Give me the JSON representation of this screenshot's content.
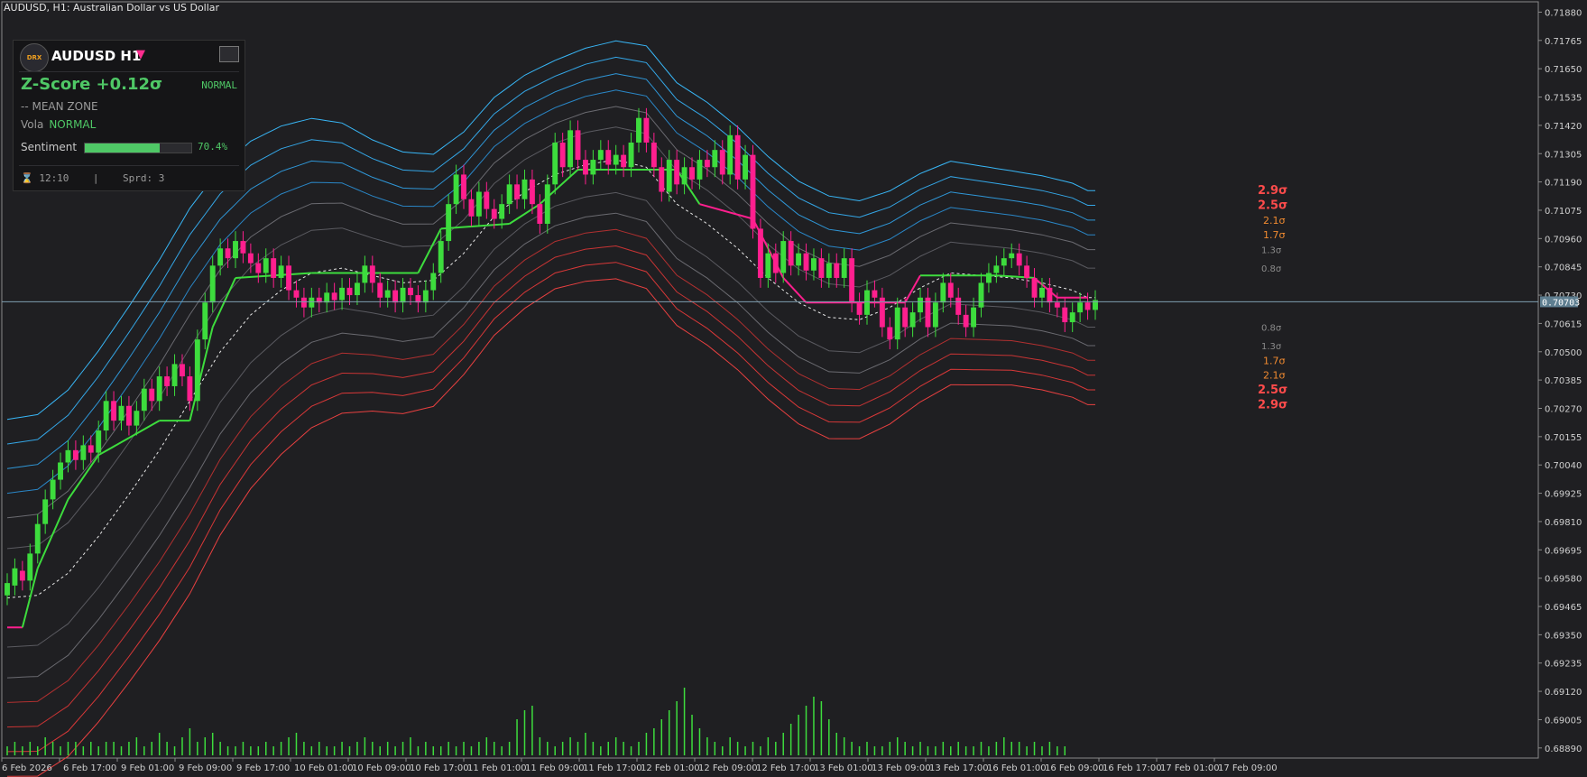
{
  "header": {
    "title": "AUDUSD, H1:  Australian Dollar vs US Dollar"
  },
  "panel": {
    "logo": "DRX",
    "symbol": "AUDUSD H1",
    "arrow": "▼",
    "zscore_label": "Z-Score  +0.12σ",
    "state": "NORMAL",
    "zone": "-- MEAN ZONE",
    "vola_label": "Vola",
    "vola_value": "NORMAL",
    "sentiment_label": "Sentiment",
    "sentiment_pct": "70.4%",
    "sentiment_value": 0.704,
    "timer_icon": "hourglass-icon",
    "footer": "⌛ 12:10    |    Sprd: 3"
  },
  "colors": {
    "bull": "#3ddc3d",
    "bear": "#ff1f8e",
    "neutral": "#707078",
    "upper": "#2fa8e8",
    "lower": "#e03838"
  },
  "chart_data": {
    "type": "candlestick",
    "symbol": "AUDUSD",
    "timeframe": "H1",
    "current_price": "0.70703",
    "y_ticks": [
      "0.71880",
      "0.71765",
      "0.71650",
      "0.71535",
      "0.71420",
      "0.71305",
      "0.71190",
      "0.71075",
      "0.70960",
      "0.70845",
      "0.70730",
      "0.70615",
      "0.70500",
      "0.70385",
      "0.70270",
      "0.70155",
      "0.70040",
      "0.69925",
      "0.69810",
      "0.69695",
      "0.69580",
      "0.69465",
      "0.69350",
      "0.69235",
      "0.69120",
      "0.69005",
      "0.68890"
    ],
    "ylim": [
      0.6886,
      0.719
    ],
    "x_ticks": [
      "6 Feb 2026",
      "6 Feb 17:00",
      "9 Feb 01:00",
      "9 Feb 09:00",
      "9 Feb 17:00",
      "10 Feb 01:00",
      "10 Feb 09:00",
      "10 Feb 17:00",
      "11 Feb 01:00",
      "11 Feb 09:00",
      "11 Feb 17:00",
      "12 Feb 01:00",
      "12 Feb 09:00",
      "12 Feb 17:00",
      "13 Feb 01:00",
      "13 Feb 09:00",
      "13 Feb 17:00",
      "16 Feb 01:00",
      "16 Feb 09:00",
      "16 Feb 17:00",
      "17 Feb 01:00",
      "17 Feb 09:00"
    ],
    "sigma_labels_upper": [
      "2.9σ",
      "2.5σ",
      "2.1σ",
      "1.7σ",
      "1.3σ",
      "0.8σ"
    ],
    "sigma_labels_lower": [
      "0.8σ",
      "1.3σ",
      "1.7σ",
      "2.1σ",
      "2.5σ",
      "2.9σ"
    ],
    "sigma_levels": [
      0.8,
      1.3,
      1.7,
      2.1,
      2.5,
      2.9
    ],
    "mean": [
      [
        0,
        0.695
      ],
      [
        4,
        0.6951
      ],
      [
        8,
        0.696
      ],
      [
        12,
        0.6975
      ],
      [
        16,
        0.6992
      ],
      [
        20,
        0.701
      ],
      [
        24,
        0.703
      ],
      [
        28,
        0.705
      ],
      [
        32,
        0.7065
      ],
      [
        36,
        0.7075
      ],
      [
        40,
        0.7082
      ],
      [
        44,
        0.7084
      ],
      [
        48,
        0.7081
      ],
      [
        52,
        0.7078
      ],
      [
        56,
        0.7079
      ],
      [
        60,
        0.709
      ],
      [
        64,
        0.7105
      ],
      [
        68,
        0.7115
      ],
      [
        72,
        0.7122
      ],
      [
        76,
        0.7126
      ],
      [
        80,
        0.7128
      ],
      [
        84,
        0.7125
      ],
      [
        88,
        0.711
      ],
      [
        92,
        0.7102
      ],
      [
        96,
        0.7092
      ],
      [
        100,
        0.708
      ],
      [
        104,
        0.707
      ],
      [
        108,
        0.7064
      ],
      [
        112,
        0.7063
      ],
      [
        116,
        0.7068
      ],
      [
        120,
        0.7076
      ],
      [
        124,
        0.7082
      ],
      [
        128,
        0.7081
      ],
      [
        132,
        0.708
      ],
      [
        136,
        0.7078
      ],
      [
        140,
        0.7075
      ],
      [
        142,
        0.7072
      ]
    ],
    "sigma_width": [
      [
        0,
        0.0025
      ],
      [
        12,
        0.0026
      ],
      [
        24,
        0.0027
      ],
      [
        36,
        0.0023
      ],
      [
        48,
        0.0019
      ],
      [
        60,
        0.0017
      ],
      [
        72,
        0.0016
      ],
      [
        84,
        0.0017
      ],
      [
        96,
        0.0017
      ],
      [
        108,
        0.0017
      ],
      [
        120,
        0.0016
      ],
      [
        132,
        0.0015
      ],
      [
        142,
        0.0015
      ]
    ],
    "trend_line": [
      [
        0,
        0.6938,
        "bear"
      ],
      [
        2,
        0.6938,
        "bull"
      ],
      [
        4,
        0.6962,
        "bull"
      ],
      [
        8,
        0.699,
        "bull"
      ],
      [
        12,
        0.7008,
        "bull"
      ],
      [
        16,
        0.7015,
        "bull"
      ],
      [
        20,
        0.7022,
        "bull"
      ],
      [
        24,
        0.7022,
        "bull"
      ],
      [
        27,
        0.706,
        "bull"
      ],
      [
        30,
        0.708,
        "bull"
      ],
      [
        40,
        0.7082,
        "bull"
      ],
      [
        54,
        0.7082,
        "bull"
      ],
      [
        57,
        0.71,
        "bull"
      ],
      [
        66,
        0.7102,
        "bull"
      ],
      [
        70,
        0.711,
        "bull"
      ],
      [
        75,
        0.7124,
        "bull"
      ],
      [
        88,
        0.7124,
        "bull"
      ],
      [
        91,
        0.711,
        "bear"
      ],
      [
        98,
        0.7104,
        "bear"
      ],
      [
        102,
        0.708,
        "bear"
      ],
      [
        105,
        0.707,
        "bear"
      ],
      [
        118,
        0.707,
        "bear"
      ],
      [
        120,
        0.7081,
        "bull"
      ],
      [
        130,
        0.7081,
        "bull"
      ],
      [
        135,
        0.708,
        "bear"
      ],
      [
        138,
        0.7072,
        "bear"
      ],
      [
        142,
        0.7072,
        "bear"
      ]
    ],
    "candles": [
      [
        0.6951,
        0.6956
      ],
      [
        0.6955,
        0.6962
      ],
      [
        0.6961,
        0.6957
      ],
      [
        0.6957,
        0.6968
      ],
      [
        0.6968,
        0.698
      ],
      [
        0.698,
        0.699
      ],
      [
        0.699,
        0.6998
      ],
      [
        0.6998,
        0.7005
      ],
      [
        0.7005,
        0.701
      ],
      [
        0.701,
        0.7006
      ],
      [
        0.7006,
        0.7012
      ],
      [
        0.7012,
        0.7009
      ],
      [
        0.7009,
        0.7018
      ],
      [
        0.7018,
        0.703
      ],
      [
        0.703,
        0.7022
      ],
      [
        0.7022,
        0.7028
      ],
      [
        0.7028,
        0.702
      ],
      [
        0.702,
        0.7026
      ],
      [
        0.7026,
        0.7035
      ],
      [
        0.7035,
        0.703
      ],
      [
        0.703,
        0.704
      ],
      [
        0.704,
        0.7036
      ],
      [
        0.7036,
        0.7045
      ],
      [
        0.7045,
        0.704
      ],
      [
        0.704,
        0.703
      ],
      [
        0.703,
        0.7055
      ],
      [
        0.7055,
        0.707
      ],
      [
        0.707,
        0.7085
      ],
      [
        0.7085,
        0.7092
      ],
      [
        0.7092,
        0.7088
      ],
      [
        0.7088,
        0.7095
      ],
      [
        0.7095,
        0.709
      ],
      [
        0.709,
        0.7086
      ],
      [
        0.7086,
        0.7082
      ],
      [
        0.7082,
        0.7088
      ],
      [
        0.7088,
        0.708
      ],
      [
        0.708,
        0.7085
      ],
      [
        0.7085,
        0.7075
      ],
      [
        0.7075,
        0.7072
      ],
      [
        0.7072,
        0.7068
      ],
      [
        0.7068,
        0.7072
      ],
      [
        0.7072,
        0.707
      ],
      [
        0.707,
        0.7074
      ],
      [
        0.7074,
        0.7071
      ],
      [
        0.7071,
        0.7076
      ],
      [
        0.7076,
        0.7073
      ],
      [
        0.7073,
        0.7078
      ],
      [
        0.7078,
        0.7085
      ],
      [
        0.7085,
        0.7078
      ],
      [
        0.7078,
        0.7072
      ],
      [
        0.7072,
        0.7075
      ],
      [
        0.7075,
        0.707
      ],
      [
        0.707,
        0.7076
      ],
      [
        0.7076,
        0.7073
      ],
      [
        0.7073,
        0.707
      ],
      [
        0.707,
        0.7075
      ],
      [
        0.7075,
        0.7082
      ],
      [
        0.7082,
        0.7095
      ],
      [
        0.7095,
        0.711
      ],
      [
        0.711,
        0.7122
      ],
      [
        0.7122,
        0.7112
      ],
      [
        0.7112,
        0.7105
      ],
      [
        0.7105,
        0.7115
      ],
      [
        0.7115,
        0.7108
      ],
      [
        0.7108,
        0.7104
      ],
      [
        0.7104,
        0.711
      ],
      [
        0.711,
        0.7118
      ],
      [
        0.7118,
        0.7112
      ],
      [
        0.7112,
        0.712
      ],
      [
        0.712,
        0.711
      ],
      [
        0.711,
        0.7102
      ],
      [
        0.7102,
        0.7118
      ],
      [
        0.7118,
        0.7135
      ],
      [
        0.7135,
        0.7125
      ],
      [
        0.7125,
        0.714
      ],
      [
        0.714,
        0.7128
      ],
      [
        0.7128,
        0.7122
      ],
      [
        0.7122,
        0.7128
      ],
      [
        0.7128,
        0.7132
      ],
      [
        0.7132,
        0.7126
      ],
      [
        0.7126,
        0.713
      ],
      [
        0.713,
        0.7125
      ],
      [
        0.7125,
        0.7135
      ],
      [
        0.7135,
        0.7145
      ],
      [
        0.7145,
        0.7135
      ],
      [
        0.7135,
        0.7125
      ],
      [
        0.7125,
        0.7115
      ],
      [
        0.7115,
        0.7128
      ],
      [
        0.7128,
        0.7118
      ],
      [
        0.7118,
        0.7125
      ],
      [
        0.7125,
        0.712
      ],
      [
        0.712,
        0.7128
      ],
      [
        0.7128,
        0.7125
      ],
      [
        0.7125,
        0.7132
      ],
      [
        0.7132,
        0.7122
      ],
      [
        0.7122,
        0.7138
      ],
      [
        0.7138,
        0.712
      ],
      [
        0.712,
        0.713
      ],
      [
        0.713,
        0.71
      ],
      [
        0.71,
        0.708
      ],
      [
        0.708,
        0.709
      ],
      [
        0.709,
        0.7082
      ],
      [
        0.7082,
        0.7095
      ],
      [
        0.7095,
        0.7085
      ],
      [
        0.7085,
        0.709
      ],
      [
        0.709,
        0.7083
      ],
      [
        0.7083,
        0.7088
      ],
      [
        0.7088,
        0.708
      ],
      [
        0.708,
        0.7086
      ],
      [
        0.7086,
        0.708
      ],
      [
        0.708,
        0.7088
      ],
      [
        0.7088,
        0.707
      ],
      [
        0.707,
        0.7065
      ],
      [
        0.7065,
        0.7075
      ],
      [
        0.7075,
        0.7072
      ],
      [
        0.7072,
        0.706
      ],
      [
        0.706,
        0.7055
      ],
      [
        0.7055,
        0.7068
      ],
      [
        0.7068,
        0.706
      ],
      [
        0.706,
        0.7066
      ],
      [
        0.7066,
        0.7072
      ],
      [
        0.7072,
        0.706
      ],
      [
        0.706,
        0.707
      ],
      [
        0.707,
        0.7078
      ],
      [
        0.7078,
        0.7072
      ],
      [
        0.7072,
        0.7065
      ],
      [
        0.7065,
        0.706
      ],
      [
        0.706,
        0.7068
      ],
      [
        0.7068,
        0.7078
      ],
      [
        0.7078,
        0.7082
      ],
      [
        0.7082,
        0.7085
      ],
      [
        0.7085,
        0.7088
      ],
      [
        0.7088,
        0.709
      ],
      [
        0.709,
        0.7085
      ],
      [
        0.7085,
        0.708
      ],
      [
        0.708,
        0.7072
      ],
      [
        0.7072,
        0.7076
      ],
      [
        0.7076,
        0.707
      ],
      [
        0.707,
        0.7068
      ],
      [
        0.7068,
        0.7062
      ],
      [
        0.7062,
        0.7066
      ],
      [
        0.7066,
        0.707
      ],
      [
        0.707,
        0.7067
      ],
      [
        0.7067,
        0.7071
      ]
    ],
    "volume": [
      2,
      3,
      2,
      3,
      2,
      4,
      3,
      2,
      3,
      3,
      2,
      3,
      2,
      3,
      3,
      2,
      3,
      4,
      2,
      3,
      5,
      3,
      2,
      4,
      6,
      3,
      4,
      5,
      3,
      2,
      2,
      3,
      2,
      2,
      3,
      2,
      3,
      4,
      5,
      3,
      2,
      3,
      2,
      2,
      3,
      2,
      3,
      4,
      3,
      2,
      3,
      2,
      3,
      4,
      2,
      3,
      2,
      2,
      3,
      2,
      3,
      2,
      3,
      4,
      3,
      2,
      3,
      8,
      10,
      11,
      4,
      3,
      2,
      3,
      4,
      3,
      5,
      3,
      2,
      3,
      4,
      3,
      2,
      3,
      5,
      6,
      8,
      10,
      12,
      15,
      9,
      6,
      4,
      3,
      2,
      4,
      3,
      2,
      3,
      2,
      4,
      3,
      5,
      7,
      9,
      11,
      13,
      12,
      8,
      5,
      4,
      3,
      2,
      3,
      2,
      2,
      3,
      4,
      3,
      2,
      3,
      2,
      2,
      3,
      2,
      3,
      2,
      2,
      3,
      2,
      3,
      4,
      3,
      3,
      2,
      3,
      2,
      3,
      2,
      2
    ]
  }
}
